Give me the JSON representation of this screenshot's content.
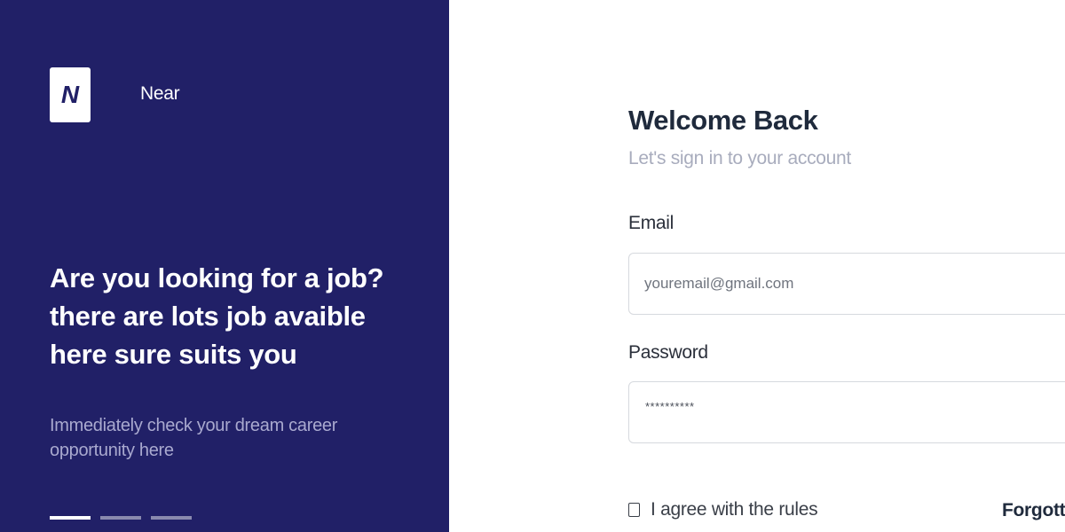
{
  "brand": {
    "logo_letter": "N",
    "name": "Near",
    "panel_color": "#212067"
  },
  "hero": {
    "headline_lines": [
      "Are you looking for a job?",
      "there are lots job avaible",
      "here sure suits you"
    ],
    "subtext": "Immediately check your dream career opportunity here",
    "carousel": {
      "count": 3,
      "active_index": 0
    }
  },
  "login": {
    "title": "Welcome Back",
    "subtitle": "Let's sign in to your account",
    "email": {
      "label": "Email",
      "placeholder": "youremail@gmail.com",
      "value": ""
    },
    "password": {
      "label": "Password",
      "masked_value": "**********"
    },
    "agree_label": "I agree with the rules",
    "agree_checked": false,
    "forgot_label": "Forgotte"
  }
}
